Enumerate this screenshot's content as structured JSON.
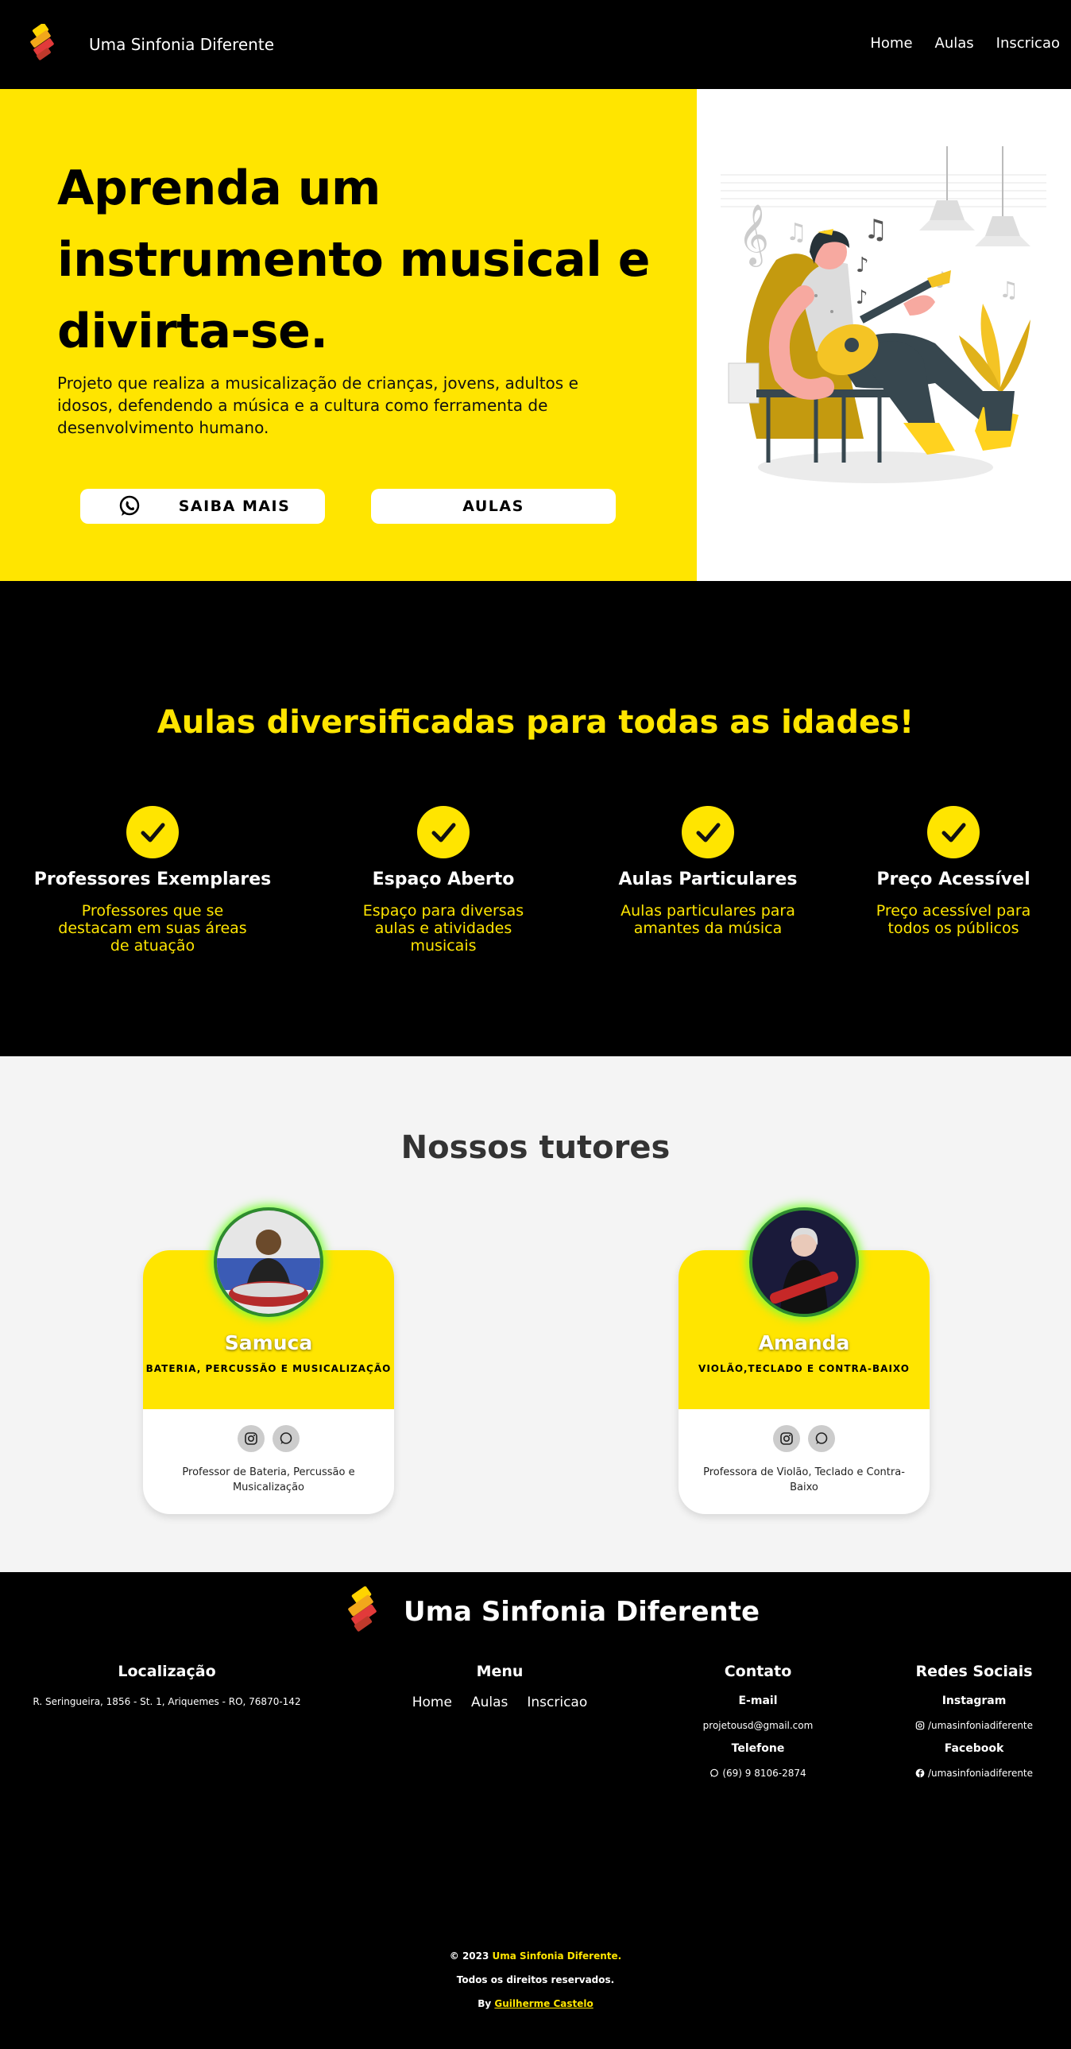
{
  "nav": {
    "brand": "Uma Sinfonia Diferente",
    "links": [
      "Home",
      "Aulas",
      "Inscricao"
    ]
  },
  "hero": {
    "title": "Aprenda um instrumento musical e divirta-se.",
    "subtitle": "Projeto que realiza a musicalização de crianças, jovens, adultos e idosos, defendendo a música e a cultura como ferramenta de desenvolvimento humano.",
    "btn_saiba": "SAIBA MAIS",
    "btn_aulas": "AULAS"
  },
  "features": {
    "heading": "Aulas diversificadas para todas as idades!",
    "items": [
      {
        "title": "Professores Exemplares",
        "desc": "Professores que se destacam em suas áreas de atuação"
      },
      {
        "title": "Espaço Aberto",
        "desc": "Espaço para diversas aulas e atividades musicais"
      },
      {
        "title": "Aulas Particulares",
        "desc": "Aulas particulares para amantes da música"
      },
      {
        "title": "Preço Acessível",
        "desc": "Preço acessível para todos os públicos"
      }
    ]
  },
  "tutors": {
    "heading": "Nossos tutores",
    "cards": [
      {
        "name": "Samuca",
        "role": "BATERIA, PERCUSSÃO E MUSICALIZAÇÃO",
        "desc": "Professor de Bateria, Percussão e Musicalização"
      },
      {
        "name": "Amanda",
        "role": "VIOLÃO,TECLADO E CONTRA-BAIXO",
        "desc": "Professora de Violão, Teclado e Contra-Baixo"
      }
    ]
  },
  "footer": {
    "brand": "Uma Sinfonia Diferente",
    "location_h": "Localização",
    "location": "R. Seringueira, 1856 - St. 1, Ariquemes - RO, 76870-142",
    "menu_h": "Menu",
    "menu": [
      "Home",
      "Aulas",
      "Inscricao"
    ],
    "contact_h": "Contato",
    "email_h": "E-mail",
    "email": "projetousd@gmail.com",
    "phone_h": "Telefone",
    "phone": "(69) 9 8106-2874",
    "social_h": "Redes Sociais",
    "insta_h": "Instagram",
    "insta": "/umasinfoniadiferente",
    "fb_h": "Facebook",
    "fb": "/umasinfoniadiferente",
    "copy_prefix": "© 2023",
    "copy_brand": "Uma Sinfonia Diferente.",
    "rights": "Todos os direitos reservados.",
    "by": "By",
    "author": "Guilherme Castelo"
  },
  "colors": {
    "accent": "#ffe500",
    "dark": "#000000",
    "light": "#f4f4f4"
  },
  "icons": [
    "logo-icon",
    "whatsapp-icon",
    "check-icon",
    "instagram-icon",
    "facebook-icon"
  ]
}
